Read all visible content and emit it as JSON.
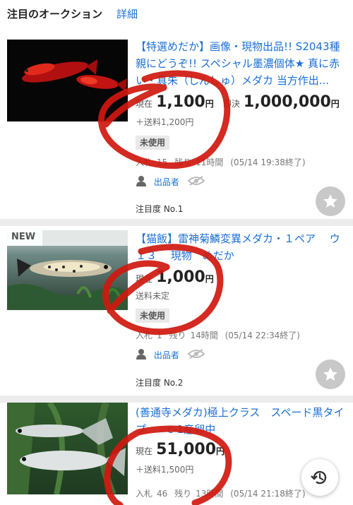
{
  "header": {
    "title": "注目のオークション",
    "detail_link": "詳細"
  },
  "items": [
    {
      "title": "【特選めだか】画像・現物出品!! S2043種親にどうぞ!! スペシャル墨濃個体★ 真に赤い・真朱（しんしゅ）メダカ 当方作出...",
      "current_label": "現在",
      "current_price": "1,100",
      "buynow_label": "即決",
      "buynow_price": "1,000,000",
      "yen": "円",
      "shipping": "＋送料1,200円",
      "condition": "未使用",
      "bids_label": "入札",
      "bids": "15",
      "remaining_label": "残り",
      "remaining": "11時間",
      "end_time": "(05/14 19:38終了)",
      "seller": "出品者",
      "rank": "注目度 No.1"
    },
    {
      "badge": "NEW",
      "title": "【猫飯】雷神菊鱗変異メダカ・１ペア　 ウ１３　 現物　めだか",
      "current_label": "現在",
      "current_price": "1,000",
      "yen": "円",
      "shipping": "送料未定",
      "condition": "未使用",
      "bids_label": "入札",
      "bids": "1",
      "remaining_label": "残り",
      "remaining": "14時間",
      "end_time": "(05/14 22:34終了)",
      "seller": "出品者",
      "rank": "注目度 No.2"
    },
    {
      "title": "(善通寺メダカ)極上クラス　スペード黒タイプ　　c-1産卵中",
      "current_label": "現在",
      "current_price": "51,000",
      "yen": "円",
      "shipping": "＋送料1,500円",
      "bids_label": "入札",
      "bids": "46",
      "remaining_label": "残り",
      "remaining": "13時間",
      "end_time": "(05/14 21:18終了)"
    }
  ],
  "icons": {
    "star": "star-icon",
    "history": "history-icon",
    "person": "person-icon",
    "eye": "eye-icon"
  },
  "colors": {
    "link": "#1a6fd6",
    "scribble": "#d0180f",
    "badge_bg": "#e9e9e9"
  }
}
